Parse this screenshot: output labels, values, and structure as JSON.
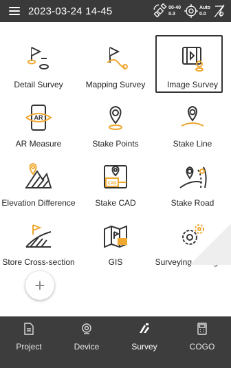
{
  "status_bar": {
    "datetime": "2023-03-24 14-45",
    "satellite": {
      "top": "00-40",
      "bottom": "0.3"
    },
    "solution": {
      "top": "Auto",
      "bottom": "0.0"
    }
  },
  "tiles": [
    {
      "label": "Detail Survey",
      "icon": "detail-survey-icon"
    },
    {
      "label": "Mapping Survey",
      "icon": "mapping-survey-icon"
    },
    {
      "label": "Image Survey",
      "icon": "image-survey-icon",
      "selected": true
    },
    {
      "label": "AR Measure",
      "icon": "ar-measure-icon",
      "icon_text": "AR"
    },
    {
      "label": "Stake Points",
      "icon": "stake-points-icon"
    },
    {
      "label": "Stake Line",
      "icon": "stake-line-icon"
    },
    {
      "label": "Elevation Difference",
      "icon": "elevation-difference-icon"
    },
    {
      "label": "Stake CAD",
      "icon": "stake-cad-icon",
      "icon_text": "CAD"
    },
    {
      "label": "Stake Road",
      "icon": "stake-road-icon"
    },
    {
      "label": "Store Cross-section",
      "icon": "store-cross-section-icon"
    },
    {
      "label": "GIS",
      "icon": "gis-icon"
    },
    {
      "label": "Surveying Configure",
      "icon": "surveying-configure-icon"
    }
  ],
  "add": {
    "symbol": "+"
  },
  "nav": [
    {
      "label": "Project",
      "icon": "project-icon"
    },
    {
      "label": "Device",
      "icon": "device-icon"
    },
    {
      "label": "Survey",
      "icon": "survey-icon",
      "active": true
    },
    {
      "label": "COGO",
      "icon": "cogo-icon"
    }
  ],
  "colors": {
    "accent": "#f0a830",
    "line": "#333333",
    "statusbar": "#3a3a3a",
    "navbar": "#3d3d3d"
  }
}
